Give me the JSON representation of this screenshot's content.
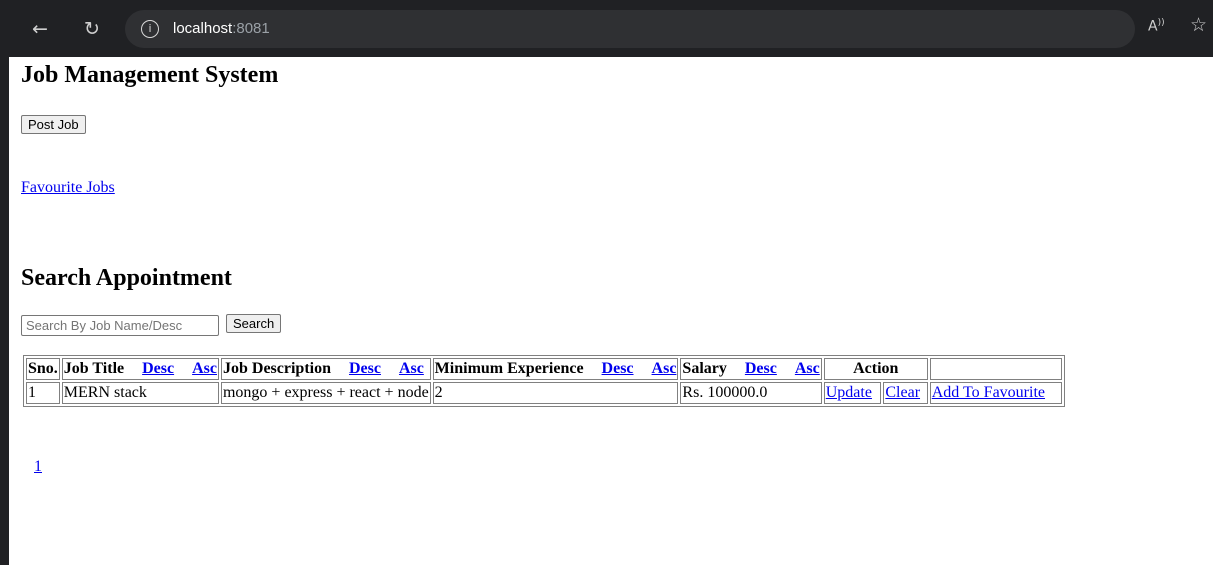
{
  "browser": {
    "url_host": "localhost",
    "url_port": ":8081",
    "icons": {
      "back": "back-arrow-icon",
      "reload": "reload-icon",
      "info": "info-icon",
      "read_aloud": "read-aloud-icon",
      "favorite": "favorite-star-icon"
    }
  },
  "page": {
    "title": "Job Management System",
    "post_job_label": "Post Job",
    "favourite_link": "Favourite Jobs",
    "search_title": "Search Appointment",
    "search_placeholder": "Search By Job Name/Desc",
    "search_button": "Search"
  },
  "table": {
    "headers": {
      "sno": "Sno.",
      "job_title": "Job Title",
      "job_description": "Job Description",
      "min_experience": "Minimum Experience",
      "salary": "Salary",
      "action": "Action",
      "desc": "Desc",
      "asc": "Asc"
    },
    "rows": [
      {
        "sno": "1",
        "job_title": "MERN stack",
        "job_description": "mongo + express + react + node",
        "min_experience": "2",
        "salary": "Rs. 100000.0",
        "update": "Update",
        "clear": "Clear",
        "add_fav": "Add To Favourite"
      }
    ]
  },
  "pagination": {
    "pages": [
      "1"
    ]
  }
}
